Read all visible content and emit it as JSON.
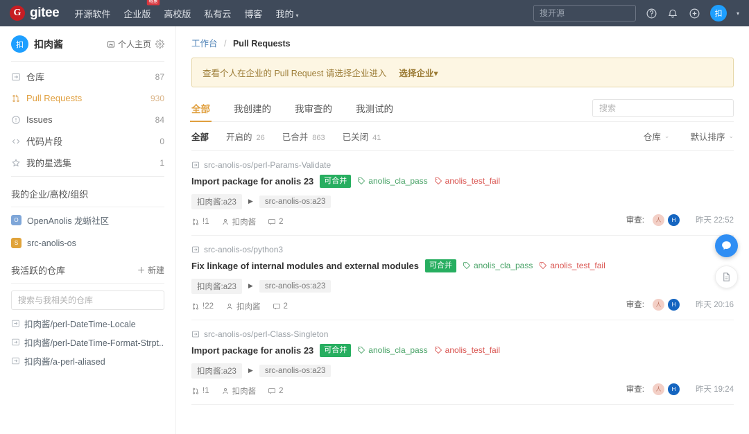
{
  "topnav": {
    "logo_letter": "G",
    "logo_text": "gitee",
    "items": [
      {
        "label": "开源软件",
        "badge": "",
        "caret": false
      },
      {
        "label": "企业版",
        "badge": "特惠",
        "caret": false
      },
      {
        "label": "高校版",
        "badge": "",
        "caret": false
      },
      {
        "label": "私有云",
        "badge": "",
        "caret": false
      },
      {
        "label": "博客",
        "badge": "",
        "caret": false
      },
      {
        "label": "我的",
        "badge": "",
        "caret": true
      }
    ],
    "search_placeholder": "搜开源",
    "icons": [
      "help-icon",
      "bell-icon",
      "plus-icon"
    ],
    "avatar_letter": "扣"
  },
  "sidebar": {
    "avatar_letter": "扣",
    "username": "扣肉酱",
    "home_link": "个人主页",
    "nav": [
      {
        "label": "仓库",
        "count": "87",
        "icon": "repo-icon",
        "active": false
      },
      {
        "label": "Pull Requests",
        "count": "930",
        "icon": "pull-request-icon",
        "active": true
      },
      {
        "label": "Issues",
        "count": "84",
        "icon": "issue-icon",
        "active": false
      },
      {
        "label": "代码片段",
        "count": "0",
        "icon": "code-icon",
        "active": false
      },
      {
        "label": "我的星选集",
        "count": "1",
        "icon": "star-icon",
        "active": false
      }
    ],
    "org_section_title": "我的企业/高校/组织",
    "orgs": [
      {
        "label": "OpenAnolis 龙蜥社区",
        "color": "#7ea6d8",
        "letter": "O"
      },
      {
        "label": "src-anolis-os",
        "color": "#e0a33a",
        "letter": "S"
      }
    ],
    "repo_section_title": "我活跃的仓库",
    "new_button": "＋ 新建",
    "repo_search_placeholder": "搜索与我相关的仓库",
    "repos": [
      "扣肉酱/perl-DateTime-Locale",
      "扣肉酱/perl-DateTime-Format-Strpt...",
      "扣肉酱/a-perl-aliased"
    ]
  },
  "breadcrumb": {
    "root": "工作台",
    "sep": "/",
    "current": "Pull Requests"
  },
  "notice": {
    "text": "查看个人在企业的 Pull Request 请选择企业进入",
    "action": "选择企业",
    "caret": "▾"
  },
  "tabs": [
    {
      "label": "全部",
      "active": true
    },
    {
      "label": "我创建的",
      "active": false
    },
    {
      "label": "我审查的",
      "active": false
    },
    {
      "label": "我测试的",
      "active": false
    }
  ],
  "tab_search_placeholder": "搜索",
  "filters": [
    {
      "label": "全部",
      "count": "",
      "active": true
    },
    {
      "label": "开启的",
      "count": "26",
      "active": false
    },
    {
      "label": "已合并",
      "count": "863",
      "active": false
    },
    {
      "label": "已关闭",
      "count": "41",
      "active": false
    }
  ],
  "dropdowns": [
    {
      "label": "仓库",
      "caret": "⌄"
    },
    {
      "label": "默认排序",
      "caret": "⌄"
    }
  ],
  "review_label": "审查:",
  "pull_requests": [
    {
      "repo": "src-anolis-os/perl-Params-Validate",
      "title": "Import package for anolis 23",
      "merge_badge": "可合并",
      "labels": [
        {
          "text": "anolis_cla_pass",
          "color": "green"
        },
        {
          "text": "anolis_test_fail",
          "color": "red"
        }
      ],
      "source_branch": "扣肉酱:a23",
      "target_branch": "src-anolis-os:a23",
      "number": "!1",
      "author": "扣肉酱",
      "comments": "2",
      "reviewers": [
        "人",
        "H"
      ],
      "time": "昨天 22:52"
    },
    {
      "repo": "src-anolis-os/python3",
      "title": "Fix linkage of internal modules and external modules",
      "merge_badge": "可合并",
      "labels": [
        {
          "text": "anolis_cla_pass",
          "color": "green"
        },
        {
          "text": "anolis_test_fail",
          "color": "red"
        }
      ],
      "source_branch": "扣肉酱:a23",
      "target_branch": "src-anolis-os:a23",
      "number": "!22",
      "author": "扣肉酱",
      "comments": "2",
      "reviewers": [
        "人",
        "H"
      ],
      "time": "昨天 20:16"
    },
    {
      "repo": "src-anolis-os/perl-Class-Singleton",
      "title": "Import package for anolis 23",
      "merge_badge": "可合并",
      "labels": [
        {
          "text": "anolis_cla_pass",
          "color": "green"
        },
        {
          "text": "anolis_test_fail",
          "color": "red"
        }
      ],
      "source_branch": "扣肉酱:a23",
      "target_branch": "src-anolis-os:a23",
      "number": "!1",
      "author": "扣肉酱",
      "comments": "2",
      "reviewers": [
        "人",
        "H"
      ],
      "time": "昨天 19:24"
    }
  ],
  "colors": {
    "nav_bg": "#3f4a5a",
    "accent": "#e09f3e",
    "merge_green": "#27ae60",
    "label_red": "#d9534f",
    "notice_bg": "#fdf6e3"
  }
}
